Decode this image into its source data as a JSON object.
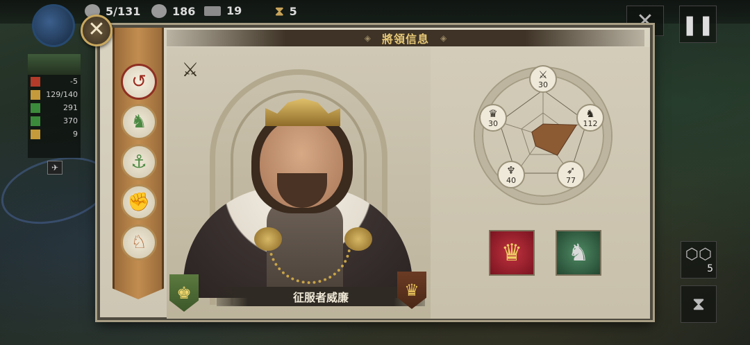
{
  "resources": [
    {
      "icon": "hourglass-icon",
      "value": "5/131"
    },
    {
      "icon": "gear-icon",
      "value": "186"
    },
    {
      "icon": "iron-bar-icon",
      "value": "19"
    },
    {
      "icon": "hourglass-icon",
      "value": "5"
    }
  ],
  "mini_stats": [
    {
      "icon": "red-unit-icon",
      "value": "-5"
    },
    {
      "icon": "soldier-icon",
      "value": "129/140"
    },
    {
      "icon": "green-unit-icon",
      "value": "291"
    },
    {
      "icon": "green-unit-icon",
      "value": "370"
    },
    {
      "icon": "boot-icon",
      "value": "9"
    }
  ],
  "right_controls": {
    "hex_count": "5"
  },
  "dialog": {
    "title": "將領信息",
    "general_name": "征服者威廉"
  },
  "tabs": [
    {
      "name": "tab-general-info",
      "icon": "swirl-icon",
      "active": true
    },
    {
      "name": "tab-horse",
      "icon": "horse-icon",
      "active": false
    },
    {
      "name": "tab-navy",
      "icon": "anchor-icon",
      "active": false
    },
    {
      "name": "tab-fist",
      "icon": "fist-icon",
      "active": false
    },
    {
      "name": "tab-cavalry",
      "icon": "knight-helmet-icon",
      "active": false
    }
  ],
  "stats": {
    "infantry": {
      "icon": "crossed-swords-icon",
      "value": "30"
    },
    "cavalry": {
      "icon": "horse-head-icon",
      "value": "112"
    },
    "archery": {
      "icon": "bow-icon",
      "value": "77"
    },
    "artillery": {
      "icon": "eagle-icon",
      "value": "40"
    },
    "command": {
      "icon": "crown-icon",
      "value": "30"
    }
  },
  "skills": [
    {
      "icon": "crown-icon",
      "color": "#b5283a"
    },
    {
      "icon": "horse-armor-icon",
      "color": "#3e7a52"
    }
  ]
}
